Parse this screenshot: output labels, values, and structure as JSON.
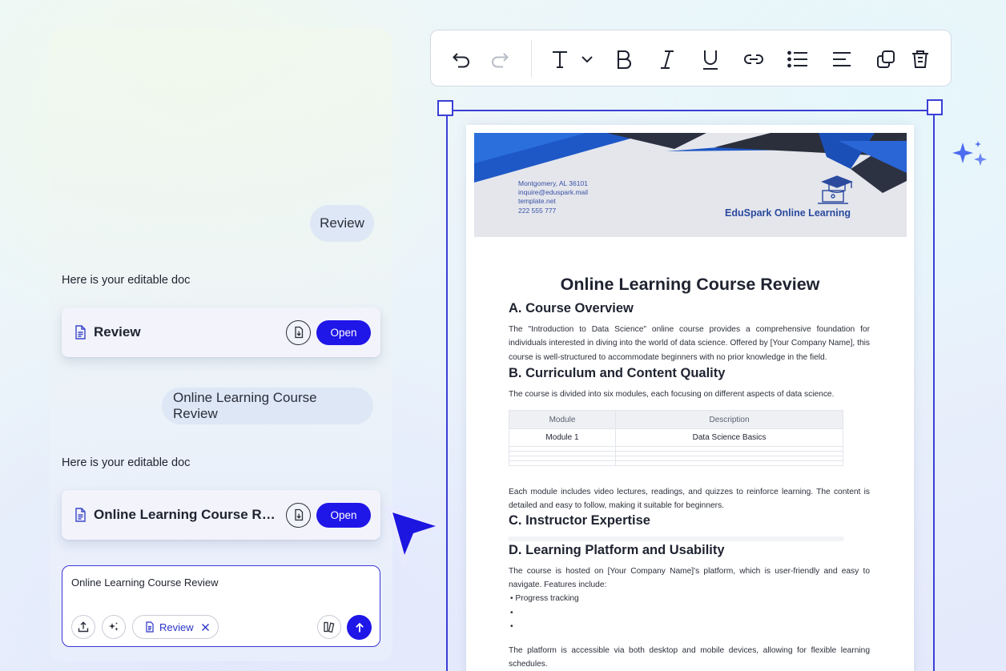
{
  "chat": {
    "messages": [
      {
        "role": "user",
        "text": "Review"
      },
      {
        "role": "assistant",
        "text": "Here is your editable doc",
        "card": {
          "title": "Review",
          "open_label": "Open"
        }
      },
      {
        "role": "user",
        "text": "Online Learning Course Review"
      },
      {
        "role": "assistant",
        "text": "Here is your editable doc",
        "card": {
          "title": "Online Learning Course Revi...",
          "open_label": "Open"
        }
      }
    ],
    "composer": {
      "text": "Online Learning Course Review",
      "attachment_label": "Review"
    }
  },
  "icons": {
    "undo": "undo-icon",
    "redo": "redo-icon",
    "text": "text-icon",
    "bold": "bold-icon",
    "italic": "italic-icon",
    "underline": "underline-icon",
    "link": "link-icon",
    "list": "list-icon",
    "align": "align-left-icon",
    "duplicate": "duplicate-icon",
    "delete": "trash-icon"
  },
  "colors": {
    "accent": "#1f16e8",
    "selection": "#3a3fd6",
    "heading": "#1f2330",
    "banner_text": "#2b4a9e"
  },
  "document": {
    "header": {
      "address": "Montgomery, AL 36101",
      "email": "inquire@eduspark.mail",
      "site": "template.net",
      "phone": "222 555 777",
      "brand": "EduSpark Online Learning"
    },
    "title": "Online Learning Course Review",
    "sections": [
      {
        "heading": "A. Course Overview",
        "body": "The \"Introduction to Data Science\" online course provides a comprehensive foundation for individuals interested in diving into the world of data science. Offered by [Your Company Name], this course is well-structured to accommodate beginners with no prior knowledge in the field."
      },
      {
        "heading": "B. Curriculum and Content Quality",
        "body": "The course is divided into six modules, each focusing on different aspects of data science.",
        "table": {
          "headers": [
            "Module",
            "Description"
          ],
          "rows": [
            [
              "Module 1",
              "Data Science Basics"
            ]
          ]
        },
        "after": "Each module includes video lectures, readings, and quizzes to reinforce learning. The content is detailed and easy to follow, making it suitable for beginners."
      },
      {
        "heading": "C. Instructor Expertise"
      },
      {
        "heading": "D. Learning Platform and Usability",
        "body": "The course is hosted on [Your Company Name]'s platform, which is user-friendly and easy to navigate. Features include:",
        "bullets": [
          "Progress tracking",
          "",
          ""
        ],
        "after": "The platform is accessible via both desktop and mobile devices, allowing for flexible learning schedules."
      }
    ]
  }
}
